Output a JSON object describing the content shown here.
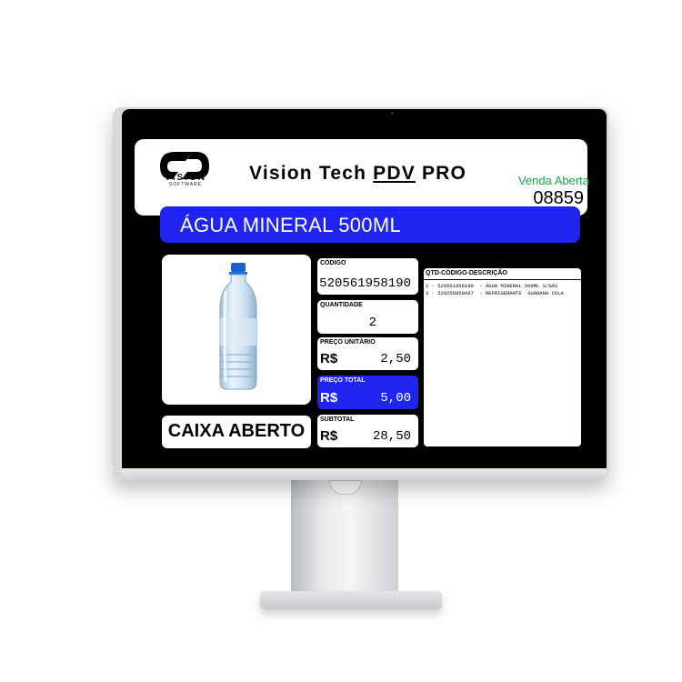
{
  "header": {
    "logo_text": "VISION",
    "logo_subtext": "SOFTWARE",
    "title_prefix": "Vision Tech ",
    "title_pdv": "PDV",
    "title_suffix": " PRO",
    "sale_status": "Venda Aberta",
    "sale_number": "08859"
  },
  "product": {
    "name": "ÁGUA MINERAL 500ML"
  },
  "register_status": "CAIXA ABERTO",
  "fields": {
    "code_label": "CÓDIGO",
    "code_value": "520561958190",
    "quantity_label": "QUANTIDADE",
    "quantity_value": "2",
    "unit_price_label": "PREÇO UNITÁRIO",
    "unit_price_currency": "R$",
    "unit_price_value": "2,50",
    "total_price_label": "PREÇO TOTAL",
    "total_price_currency": "R$",
    "total_price_value": "5,00",
    "subtotal_label": "SUBTOTAL",
    "subtotal_currency": "R$",
    "subtotal_value": "28,50"
  },
  "items": {
    "header": "QTD-CÓDIGO-DESCRIÇÃO",
    "rows": [
      "2 - 520561958190  - ÁGUA MINERAL 500ML S/GÁS",
      "3 - 520258958097  - REFRIGERANTE  GUARANA COLA"
    ]
  },
  "colors": {
    "accent_blue": "#1f24f0",
    "status_green": "#19a64a"
  }
}
